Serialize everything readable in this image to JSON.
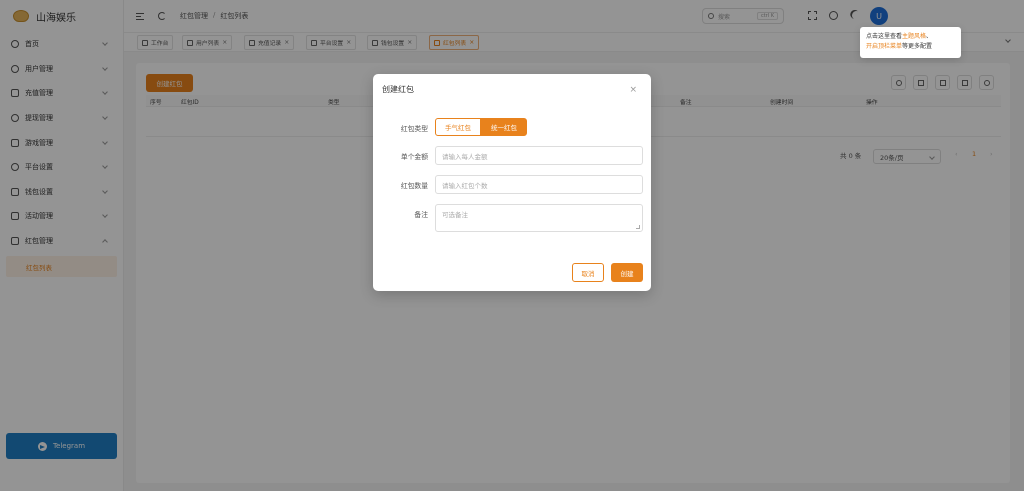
{
  "app": {
    "name": "山海娱乐"
  },
  "sidebar": {
    "items": [
      {
        "label": "首页"
      },
      {
        "label": "用户管理"
      },
      {
        "label": "充值管理"
      },
      {
        "label": "提现管理"
      },
      {
        "label": "游戏管理"
      },
      {
        "label": "平台设置"
      },
      {
        "label": "钱包设置"
      },
      {
        "label": "活动管理"
      },
      {
        "label": "红包管理"
      }
    ],
    "sub_active": "红包列表",
    "telegram_label": "Telegram"
  },
  "header": {
    "breadcrumb": [
      "红包管理",
      "红包列表"
    ],
    "breadcrumb_sep": "/",
    "search_placeholder": "搜索",
    "search_shortcut": "ctrl K",
    "avatar_letter": "U"
  },
  "tabs": [
    {
      "label": "工作台"
    },
    {
      "label": "用户列表"
    },
    {
      "label": "充值记录"
    },
    {
      "label": "平台设置"
    },
    {
      "label": "钱包设置"
    },
    {
      "label": "红包列表",
      "active": true
    }
  ],
  "tab_close": "×",
  "tooltip": {
    "line1_prefix": "点击这里查看",
    "line1_link": "主题风格",
    "line1_suffix": "、",
    "line2_link": "开启顶栏菜单",
    "line2_suffix": "等更多配置"
  },
  "main": {
    "create_label": "创建红包",
    "columns": [
      "序号",
      "红包ID",
      "类型",
      "备注",
      "创建时间",
      "操作"
    ],
    "total_label": "共 0 条",
    "page_size": "20条/页",
    "prev": "‹",
    "page": "1",
    "next": "›"
  },
  "modal": {
    "title": "创建红包",
    "close": "×",
    "type_label": "红包类型",
    "type_options": [
      "手气红包",
      "统一红包"
    ],
    "type_selected": "统一红包",
    "amount_label": "单个金额",
    "amount_placeholder": "请输入每人金额",
    "count_label": "红包数量",
    "count_placeholder": "请输入红包个数",
    "note_label": "备注",
    "note_placeholder": "可选备注",
    "cancel_label": "取消",
    "ok_label": "创建"
  },
  "colors": {
    "accent": "#e8821c",
    "telegram": "#1f7fc4",
    "avatar": "#1e6fd9"
  }
}
